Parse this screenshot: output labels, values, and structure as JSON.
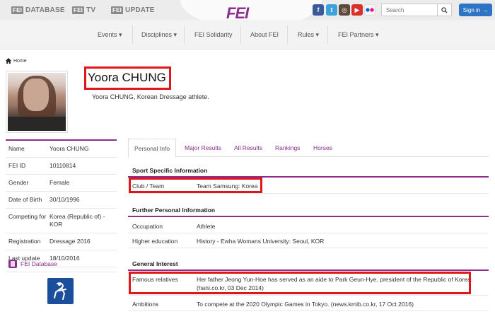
{
  "header": {
    "links": [
      {
        "badge": "FEI",
        "label": "DATABASE"
      },
      {
        "badge": "FEI",
        "label": "TV"
      },
      {
        "badge": "FEI",
        "label": "UPDATE"
      }
    ],
    "logo": "FEI",
    "search_placeholder": "Search",
    "signin_label": "Sign in",
    "colors": {
      "brand": "#8b2d8b",
      "signin": "#2d74c4",
      "highlight": "#e0161d"
    }
  },
  "nav": {
    "items": [
      "Events",
      "Disciplines",
      "FEI Solidarity",
      "About FEI",
      "Rules",
      "FEI Partners"
    ]
  },
  "breadcrumb": {
    "home": "Home"
  },
  "profile": {
    "name": "Yoora CHUNG",
    "summary": "Yoora CHUNG, Korean Dressage athlete."
  },
  "info": {
    "rows": [
      {
        "key": "Name",
        "value": "Yoora CHUNG"
      },
      {
        "key": "FEI ID",
        "value": "10110814"
      },
      {
        "key": "Gender",
        "value": "Female"
      },
      {
        "key": "Date of Birth",
        "value": "30/10/1996"
      },
      {
        "key": "Competing for",
        "value": "Korea (Republic of) - KOR"
      },
      {
        "key": "Registration",
        "value": "Dressage 2016"
      },
      {
        "key": "Last update",
        "value": "18/10/2016"
      }
    ],
    "db_link": "FEI Database"
  },
  "tabs": [
    "Personal Info",
    "Major Results",
    "All Results",
    "Rankings",
    "Horses"
  ],
  "sections": {
    "sport": {
      "title": "Sport Specific Information",
      "rows": [
        {
          "key": "Club / Team",
          "value": "Team Samsung: Korea"
        }
      ]
    },
    "personal": {
      "title": "Further Personal Information",
      "rows": [
        {
          "key": "Occupation",
          "value": "Athlete"
        },
        {
          "key": "Higher education",
          "value": "History - Ewha Womans University: Seoul, KOR"
        }
      ]
    },
    "interest": {
      "title": "General Interest",
      "rows": [
        {
          "key": "Famous relatives",
          "value_line1": "Her father Jeong Yun-Hoe has served as an aide to Park Geun-Hye, president of the Republic of Korea.",
          "value_line2": "(hani.co.kr, 03 Dec 2014)"
        },
        {
          "key": "Ambitions",
          "value_line1": "To compete at the 2020 Olympic Games in Tokyo. (news.kmib.co.kr, 17 Oct 2016)"
        }
      ]
    }
  }
}
